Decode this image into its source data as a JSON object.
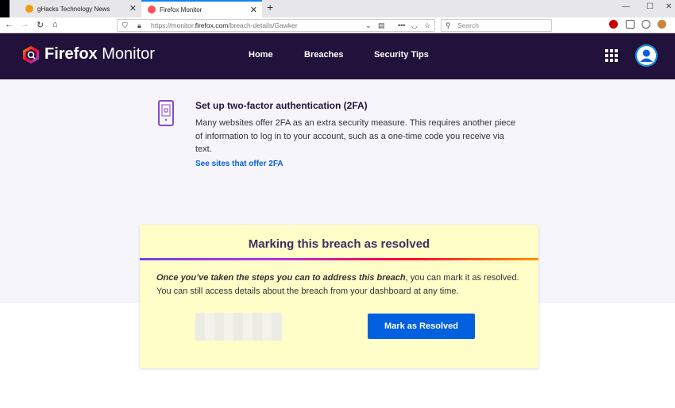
{
  "browser": {
    "tabs": [
      {
        "title": "gHacks Technology News",
        "active": false
      },
      {
        "title": "Firefox Monitor",
        "active": true
      }
    ],
    "url_prefix": "https://monitor.",
    "url_domain": "firefox.com",
    "url_path": "/breach-details/Gawker",
    "search_placeholder": "Search"
  },
  "header": {
    "logo_bold": "Firefox",
    "logo_light": " Monitor",
    "nav": [
      "Home",
      "Breaches",
      "Security Tips"
    ]
  },
  "twofa": {
    "title": "Set up two-factor authentication (2FA)",
    "body": "Many websites offer 2FA as an extra security measure. This requires another piece of information to log in to your account, such as a one-time code you receive via text.",
    "link": "See sites that offer 2FA"
  },
  "resolve_card": {
    "title": "Marking this breach as resolved",
    "body_emphasis": "Once you’ve taken the steps you can to address this breach",
    "body_rest": ", you can mark it as resolved. You can still access details about the breach from your dashboard at any time.",
    "button": "Mark as Resolved"
  },
  "colors": {
    "header_bg": "#20123a",
    "accent_blue": "#0060df",
    "card_bg": "#fffdc8",
    "page_bg": "#f7f5fc"
  }
}
